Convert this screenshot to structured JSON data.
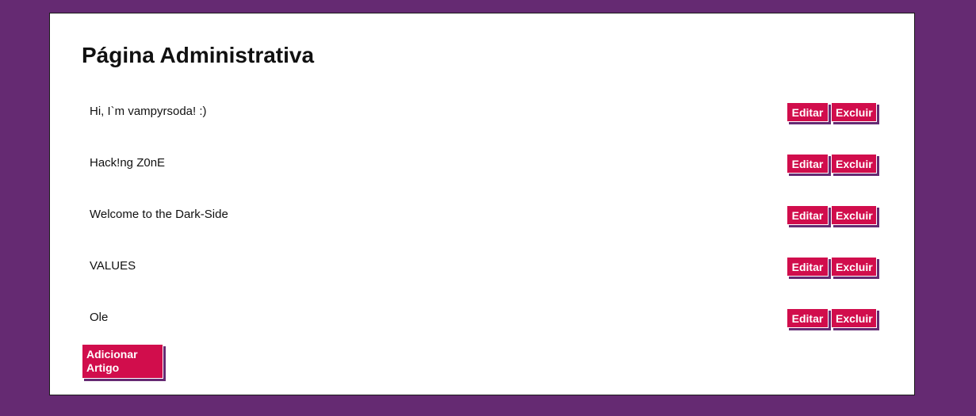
{
  "page": {
    "title": "Página Administrativa"
  },
  "articles": [
    {
      "title": "Hi, I`m vampyrsoda! :)",
      "edit_label": "Editar",
      "delete_label": "Excluir"
    },
    {
      "title": "Hack!ng Z0nE",
      "edit_label": "Editar",
      "delete_label": "Excluir"
    },
    {
      "title": "Welcome to the Dark-Side",
      "edit_label": "Editar",
      "delete_label": "Excluir"
    },
    {
      "title": "VALUES",
      "edit_label": "Editar",
      "delete_label": "Excluir"
    },
    {
      "title": "Ole",
      "edit_label": "Editar",
      "delete_label": "Excluir"
    }
  ],
  "add_article_label": "Adicionar Artigo",
  "colors": {
    "background": "#652a72",
    "panel": "#ffffff",
    "button": "#d10d4c",
    "button_text": "#ffffff"
  }
}
